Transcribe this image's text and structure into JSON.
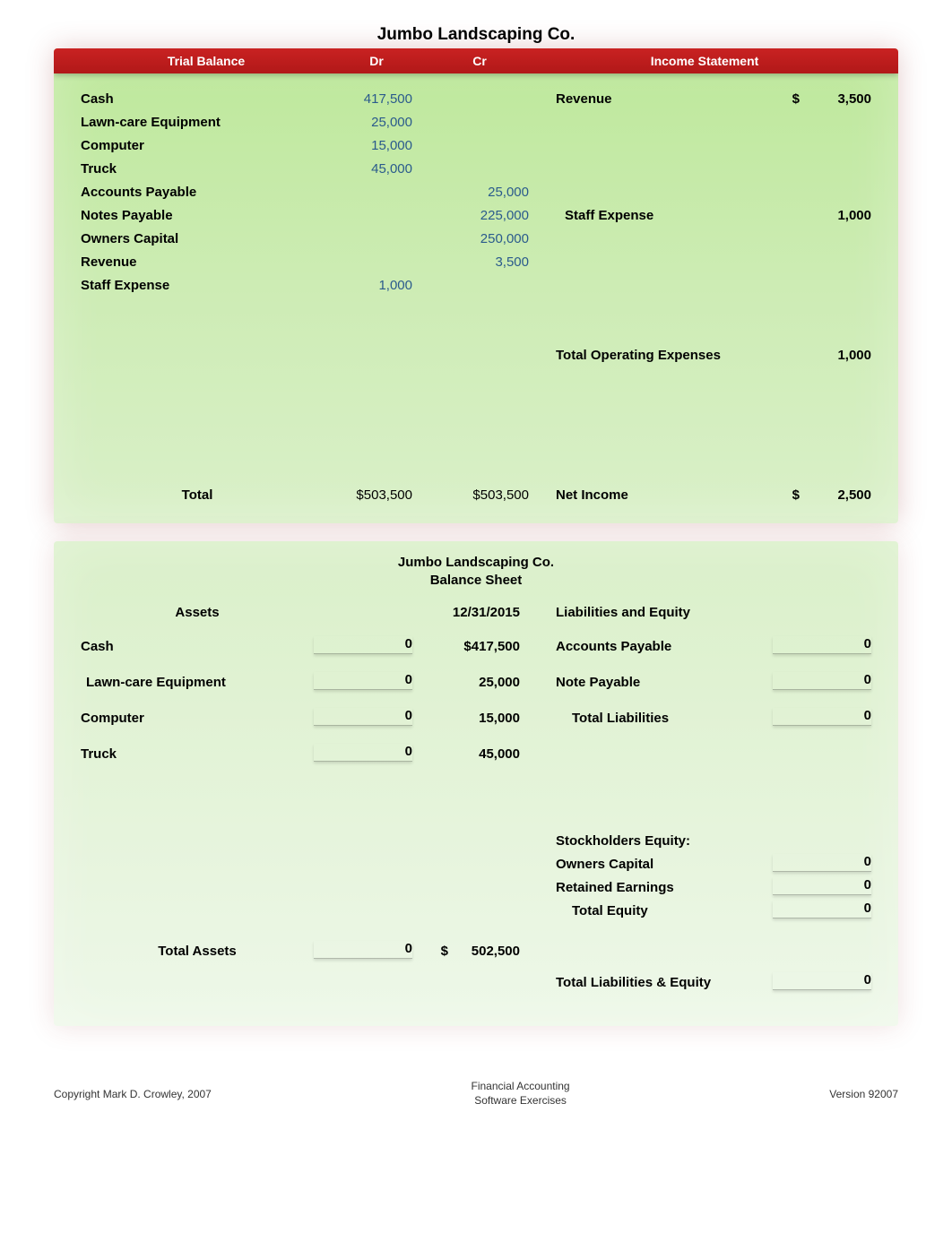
{
  "company": "Jumbo Landscaping Co.",
  "redbar": {
    "trial_balance": "Trial Balance",
    "dr": "Dr",
    "cr": "Cr",
    "income_statement": "Income Statement"
  },
  "trial_balance": {
    "rows": [
      {
        "acct": "Cash",
        "dr": "417,500",
        "cr": ""
      },
      {
        "acct": "Lawn-care Equipment",
        "dr": "25,000",
        "cr": ""
      },
      {
        "acct": "Computer",
        "dr": "15,000",
        "cr": ""
      },
      {
        "acct": "Truck",
        "dr": "45,000",
        "cr": ""
      },
      {
        "acct": "Accounts Payable",
        "dr": "",
        "cr": "25,000"
      },
      {
        "acct": "Notes Payable",
        "dr": "",
        "cr": "225,000"
      },
      {
        "acct": "Owners Capital",
        "dr": "",
        "cr": "250,000"
      },
      {
        "acct": "Revenue",
        "dr": "",
        "cr": "3,500"
      },
      {
        "acct": "Staff Expense",
        "dr": "1,000",
        "cr": ""
      }
    ],
    "total_label": "Total",
    "total_dr": "$503,500",
    "total_cr": "$503,500"
  },
  "income_statement": {
    "revenue_label": "Revenue",
    "revenue_sym": "$",
    "revenue_val": "3,500",
    "staff_expense_label": "Staff Expense",
    "staff_expense_val": "1,000",
    "toe_label": "Total Operating Expenses",
    "toe_val": "1,000",
    "net_income_label": "Net Income",
    "net_income_sym": "$",
    "net_income_val": "2,500"
  },
  "balance_sheet": {
    "title_line1": "Jumbo Landscaping Co.",
    "title_line2": "Balance Sheet",
    "assets_header": "Assets",
    "date": "12/31/2015",
    "liab_header": "Liabilities and Equity",
    "assets": [
      {
        "label": "Cash",
        "input": "0",
        "value": "$417,500"
      },
      {
        "label": "Lawn-care Equipment",
        "input": "0",
        "value": "25,000"
      },
      {
        "label": "Computer",
        "input": "0",
        "value": "15,000"
      },
      {
        "label": "Truck",
        "input": "0",
        "value": "45,000"
      }
    ],
    "liabilities": [
      {
        "label": "Accounts Payable",
        "input": "0"
      },
      {
        "label": "Note Payable",
        "input": "0"
      },
      {
        "label": "Total Liabilities",
        "input": "0"
      }
    ],
    "equity_header": "Stockholders Equity:",
    "equity": [
      {
        "label": "Owners Capital",
        "input": "0"
      },
      {
        "label": "Retained Earnings",
        "input": "0"
      },
      {
        "label": "Total  Equity",
        "input": "0"
      }
    ],
    "total_assets_label": "Total Assets",
    "total_assets_input": "0",
    "total_assets_sym": "$",
    "total_assets_value": "502,500",
    "total_le_label": "Total Liabilities & Equity",
    "total_le_input": "0"
  },
  "footer": {
    "left": "Copyright Mark D. Crowley, 2007",
    "mid1": "Financial Accounting",
    "mid2": "Software Exercises",
    "right": "Version 92007"
  }
}
